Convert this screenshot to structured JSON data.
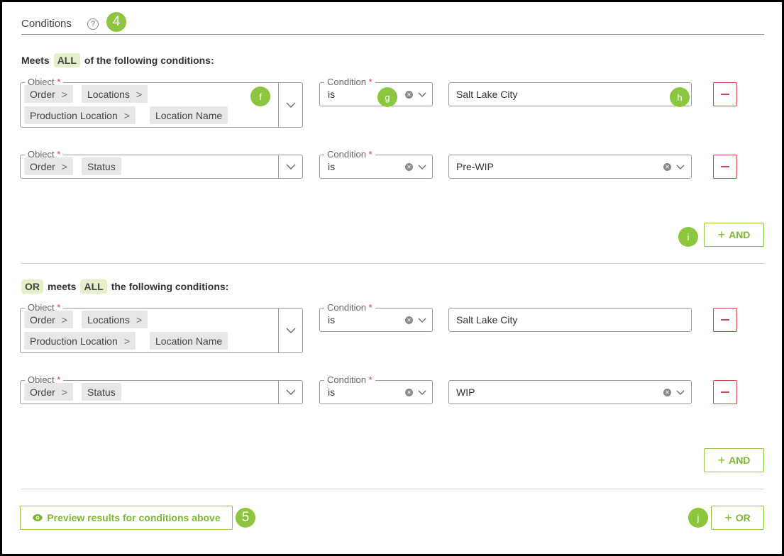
{
  "header": {
    "title": "Conditions",
    "help_icon": "?",
    "step_badge": "4"
  },
  "group1": {
    "heading_pre": "Meets",
    "heading_pill": "ALL",
    "heading_post": "of the following conditions:",
    "rows": [
      {
        "object_label": "Object",
        "object_tags": [
          "Order",
          "Locations",
          "Production Location",
          "Location Name"
        ],
        "condition_label": "Condition",
        "condition_value": "is",
        "value": "Salt Lake City"
      },
      {
        "object_label": "Object",
        "object_tags": [
          "Order",
          "Status"
        ],
        "condition_label": "Condition",
        "condition_value": "is",
        "value": "Pre-WIP"
      }
    ],
    "and_label": "AND"
  },
  "group2": {
    "heading_or": "OR",
    "heading_mid": "meets",
    "heading_pill": "ALL",
    "heading_post": "the following conditions:",
    "rows": [
      {
        "object_label": "Object",
        "object_tags": [
          "Order",
          "Locations",
          "Production Location",
          "Location Name"
        ],
        "condition_label": "Condition",
        "condition_value": "is",
        "value": "Salt Lake City"
      },
      {
        "object_label": "Object",
        "object_tags": [
          "Order",
          "Status"
        ],
        "condition_label": "Condition",
        "condition_value": "is",
        "value": "WIP"
      }
    ],
    "and_label": "AND"
  },
  "footer": {
    "preview_label": "Preview results for conditions above",
    "preview_badge": "5",
    "or_label": "OR"
  },
  "annotations": {
    "f": "f",
    "g": "g",
    "h": "h",
    "i": "i",
    "j": "j"
  },
  "required_mark": "*",
  "colors": {
    "accent_green": "#8cc63f",
    "danger_red": "#d04a50",
    "tag_gray": "#e7e7e7"
  }
}
